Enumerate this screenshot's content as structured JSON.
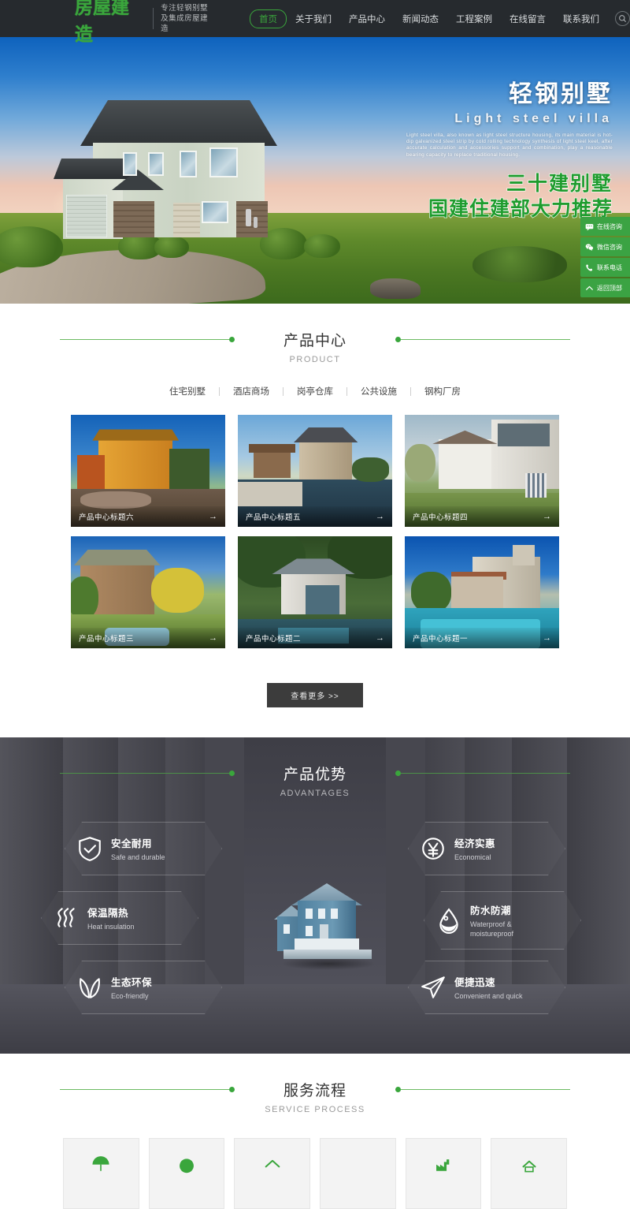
{
  "header": {
    "logo_main": "房屋建造",
    "logo_sub_line1": "专注轻钢别墅",
    "logo_sub_line2": "及集成房屋建造",
    "nav": [
      {
        "label": "首页",
        "active": true
      },
      {
        "label": "关于我们",
        "active": false
      },
      {
        "label": "产品中心",
        "active": false
      },
      {
        "label": "新闻动态",
        "active": false
      },
      {
        "label": "工程案例",
        "active": false
      },
      {
        "label": "在线留言",
        "active": false
      },
      {
        "label": "联系我们",
        "active": false
      }
    ],
    "search_icon": "search-icon",
    "bg_color": "#262a2e",
    "accent_color": "#3aa63c"
  },
  "hero": {
    "title_cn": "轻钢别墅",
    "title_en": "Light steel villa",
    "paragraph": "Light steel villa, also known as light steel structure housing, its main material is hot-dip galvanized steel strip by cold rolling technology synthesis of light steel keel, after accurate calculation and accessories support and combination, play a reasonable bearing capacity to replace traditional housing.",
    "slogan_line1": "三十建别墅",
    "slogan_line2": "国建住建部大力推荐",
    "slogan_color": "#1f9c2e"
  },
  "side_float": {
    "buttons": [
      {
        "label": "在线咨询",
        "icon": "chat-icon"
      },
      {
        "label": "微信咨询",
        "icon": "wechat-icon"
      },
      {
        "label": "联系电话",
        "icon": "phone-icon"
      },
      {
        "label": "返回顶部",
        "icon": "arrow-up-icon"
      }
    ],
    "bg_color": "#3ba343"
  },
  "product": {
    "title_cn": "产品中心",
    "title_en": "PRODUCT",
    "tabs": [
      "住宅别墅",
      "酒店商场",
      "岗亭仓库",
      "公共设施",
      "钢构厂房"
    ],
    "cards": [
      {
        "title": "产品中心标题六",
        "arrow": "→"
      },
      {
        "title": "产品中心标题五",
        "arrow": "→"
      },
      {
        "title": "产品中心标题四",
        "arrow": "→"
      },
      {
        "title": "产品中心标题三",
        "arrow": "→"
      },
      {
        "title": "产品中心标题二",
        "arrow": "→"
      },
      {
        "title": "产品中心标题一",
        "arrow": "→"
      }
    ],
    "more_label": "查看更多 >>"
  },
  "advantages": {
    "title_cn": "产品优势",
    "title_en": "ADVANTAGES",
    "bg_color": "#47474f",
    "left": [
      {
        "cn": "安全耐用",
        "en": "Safe and durable",
        "icon": "shield-check-icon"
      },
      {
        "cn": "保温隔热",
        "en": "Heat insulation",
        "icon": "heat-waves-icon"
      },
      {
        "cn": "生态环保",
        "en": "Eco-friendly",
        "icon": "leaf-icon"
      }
    ],
    "right": [
      {
        "cn": "经济实惠",
        "en": "Economical",
        "icon": "coin-yuan-icon"
      },
      {
        "cn": "防水防潮",
        "en": "Waterproof & moistureproof",
        "icon": "water-drop-icon"
      },
      {
        "cn": "便捷迅速",
        "en": "Convenient and quick",
        "icon": "paper-plane-icon"
      }
    ]
  },
  "process": {
    "title_cn": "服务流程",
    "title_en": "SERVICE PROCESS",
    "cards": [
      {
        "icon": "umbrella-icon"
      },
      {
        "icon": "circle-icon"
      },
      {
        "icon": "home-icon"
      },
      {
        "icon": "blank-icon"
      },
      {
        "icon": "factory-icon"
      },
      {
        "icon": "house-icon"
      }
    ]
  }
}
